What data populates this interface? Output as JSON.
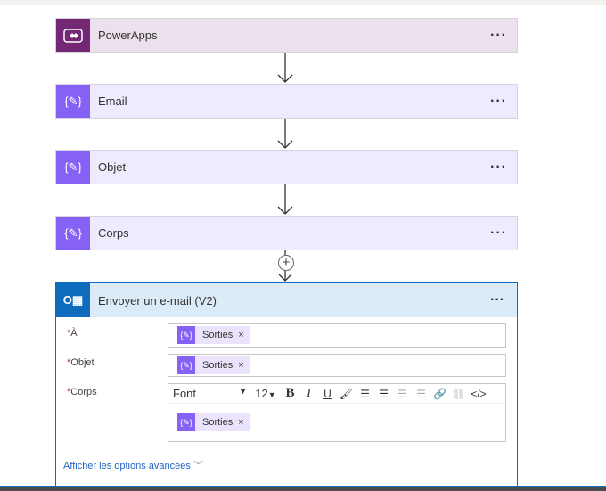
{
  "steps": [
    {
      "title": "PowerApps",
      "icon": "powerapps-icon"
    },
    {
      "title": "Email",
      "icon": "variable-icon"
    },
    {
      "title": "Objet",
      "icon": "variable-icon"
    },
    {
      "title": "Corps",
      "icon": "variable-icon"
    }
  ],
  "more": "···",
  "add": "+",
  "action": {
    "title": "Envoyer un e-mail (V2)",
    "required": "*",
    "fields": [
      {
        "label": "À",
        "token": "Sorties"
      },
      {
        "label": "Objet",
        "token": "Sorties"
      },
      {
        "label": "Corps",
        "token": "Sorties"
      }
    ],
    "toolbar": {
      "font": "Font",
      "size": "12",
      "bold": "B",
      "italic": "I",
      "underline": "U",
      "code": "</>"
    },
    "remove": "×",
    "advanced": "Afficher les options avancées"
  },
  "colors": {
    "powerapps": "#742774",
    "variable": "#8661f5",
    "outlook": "#0f6cbd"
  }
}
